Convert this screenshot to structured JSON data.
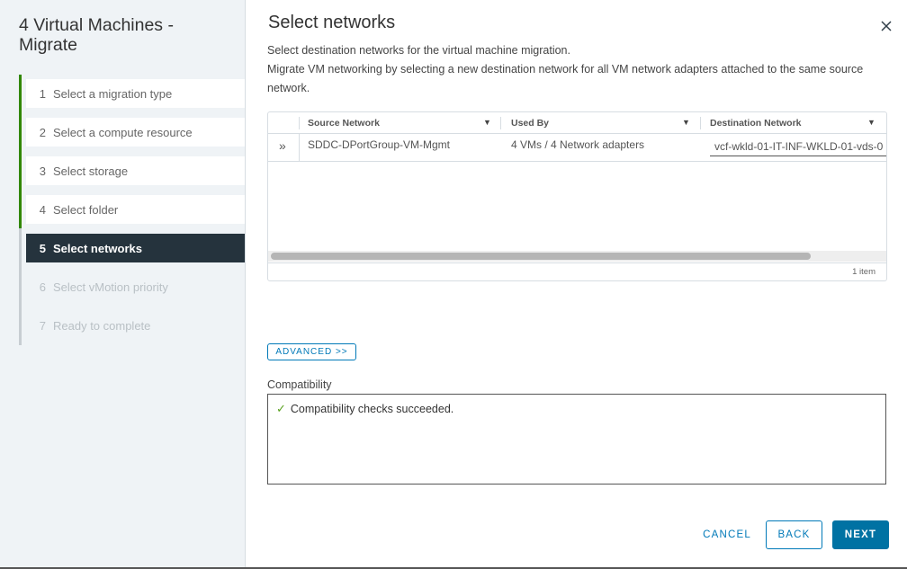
{
  "wizard": {
    "title": "4 Virtual Machines - Migrate",
    "steps": [
      {
        "num": "1",
        "label": "Select a migration type",
        "state": "done"
      },
      {
        "num": "2",
        "label": "Select a compute resource",
        "state": "done"
      },
      {
        "num": "3",
        "label": "Select storage",
        "state": "done"
      },
      {
        "num": "4",
        "label": "Select folder",
        "state": "done"
      },
      {
        "num": "5",
        "label": "Select networks",
        "state": "active"
      },
      {
        "num": "6",
        "label": "Select vMotion priority",
        "state": "future"
      },
      {
        "num": "7",
        "label": "Ready to complete",
        "state": "future"
      }
    ]
  },
  "page": {
    "title": "Select networks",
    "description_line1": "Select destination networks for the virtual machine migration.",
    "description_line2": "Migrate VM networking by selecting a new destination network for all VM network adapters attached to the same source network.",
    "close_icon": "close-icon"
  },
  "grid": {
    "columns": [
      "Source Network",
      "Used By",
      "Destination Network"
    ],
    "rows": [
      {
        "expand_icon": "»",
        "source": "SDDC-DPortGroup-VM-Mgmt",
        "used_by": "4 VMs / 4 Network adapters",
        "destination": "vcf-wkld-01-IT-INF-WKLD-01-vds-0"
      }
    ],
    "footer": "1 item"
  },
  "advanced_label": "ADVANCED >>",
  "compatibility": {
    "label": "Compatibility",
    "message": "Compatibility checks succeeded.",
    "status_color": "#5aa220"
  },
  "buttons": {
    "cancel": "CANCEL",
    "back": "BACK",
    "next": "NEXT"
  },
  "colors": {
    "primary": "#0072a3",
    "done_rail": "#318700",
    "active_step_bg": "#25333d"
  }
}
